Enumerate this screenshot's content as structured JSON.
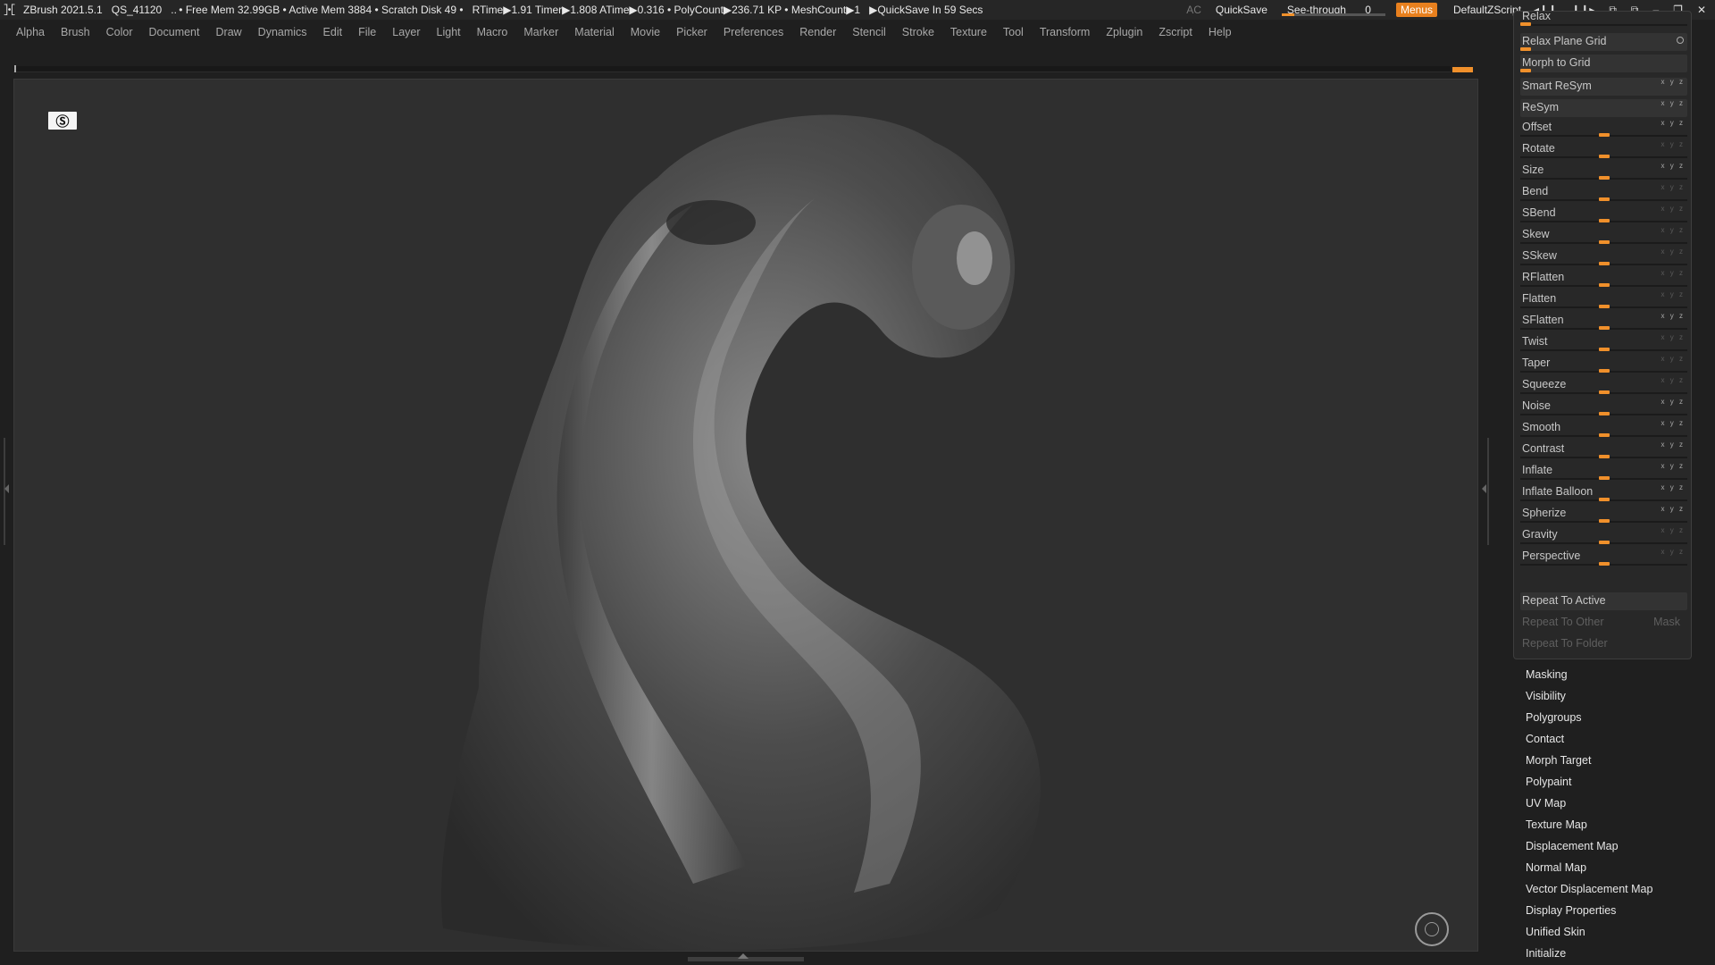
{
  "titlebar": {
    "app": "ZBrush 2021.5.1",
    "project": "QS_41120",
    "stats": ".. • Free Mem 32.99GB • Active Mem 3884 • Scratch Disk 49 •",
    "timers": "RTime▶1.91 Timer▶1.808 ATime▶0.316 • PolyCount▶236.71 KP • MeshCount▶1",
    "quicksave_info": "▶QuickSave In 59 Secs",
    "ac": "AC",
    "quicksave": "QuickSave",
    "seethrough": "See-through",
    "seethrough_value": "0",
    "menus": "Menus",
    "script": "DefaultZScript"
  },
  "menubar": [
    "Alpha",
    "Brush",
    "Color",
    "Document",
    "Draw",
    "Dynamics",
    "Edit",
    "File",
    "Layer",
    "Light",
    "Macro",
    "Marker",
    "Material",
    "Movie",
    "Picker",
    "Preferences",
    "Render",
    "Stencil",
    "Stroke",
    "Texture",
    "Tool",
    "Transform",
    "Zplugin",
    "Zscript",
    "Help"
  ],
  "deformation": {
    "top_partial": "Relax",
    "buttons": [
      "Relax Plane Grid",
      "Morph to Grid",
      "Smart ReSym",
      "ReSym"
    ],
    "sliders": [
      "Offset",
      "Rotate",
      "Size",
      "Bend",
      "SBend",
      "Skew",
      "SSkew",
      "RFlatten",
      "Flatten",
      "SFlatten",
      "Twist",
      "Taper",
      "Squeeze",
      "Noise",
      "Smooth",
      "Contrast",
      "Inflate",
      "Inflate Balloon",
      "Spherize",
      "Gravity",
      "Perspective"
    ],
    "repeat_active": "Repeat To Active",
    "repeat_other": "Repeat To Other",
    "mask": "Mask",
    "repeat_folder": "Repeat To Folder"
  },
  "subpalettes": [
    "Masking",
    "Visibility",
    "Polygroups",
    "Contact",
    "Morph Target",
    "Polypaint",
    "UV Map",
    "Texture Map",
    "Displacement Map",
    "Normal Map",
    "Vector Displacement Map",
    "Display Properties",
    "Unified Skin",
    "Initialize"
  ],
  "colors": {
    "accent": "#f0902b",
    "menus": "#e8801e",
    "background": "#2f2f2f"
  }
}
